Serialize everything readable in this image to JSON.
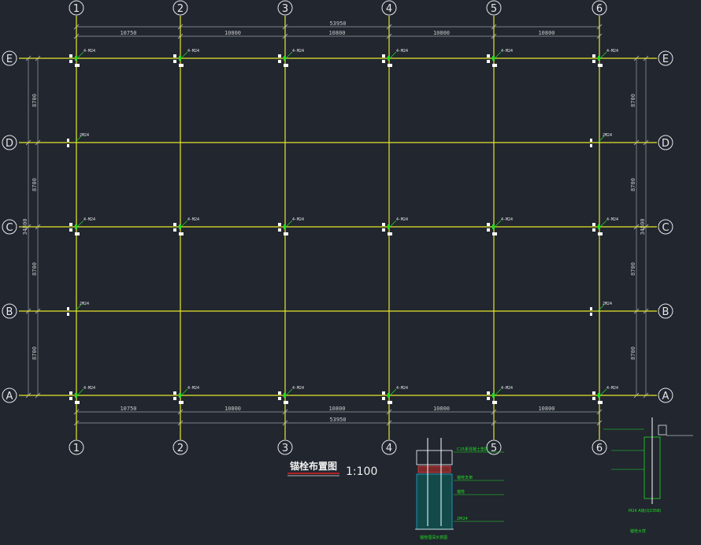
{
  "drawing": {
    "title": "锚栓布置图",
    "scale": "1:100",
    "colors": {
      "background": "#21262f",
      "grid_line": "#e6e62a",
      "dimension": "#9aa0a8",
      "bubble": "#e8e8e8",
      "annotation": "#22dd22",
      "marker": "#ffffff",
      "title_underline": "#e02020"
    }
  },
  "axes": {
    "columns": [
      "1",
      "2",
      "3",
      "4",
      "5",
      "6"
    ],
    "rows": [
      "E",
      "D",
      "C",
      "B",
      "A"
    ]
  },
  "dimensions": {
    "column_spacings": [
      "10750",
      "10800",
      "10800",
      "10800",
      "10800"
    ],
    "column_total": "53950",
    "row_spacings": [
      "8700",
      "8700",
      "8700",
      "8700"
    ],
    "row_total": "34800"
  },
  "anchor_tags": {
    "corner": "4-M24",
    "edge": "2M24"
  },
  "details": {
    "section_title": "锚栓埋深示意图",
    "section_labels": [
      "锚栓",
      "C15素混凝土垫层",
      "锚栓支架",
      "2M24"
    ],
    "plate_title": "锚栓大样",
    "plate_label": "M24 A级(Q235B)"
  }
}
